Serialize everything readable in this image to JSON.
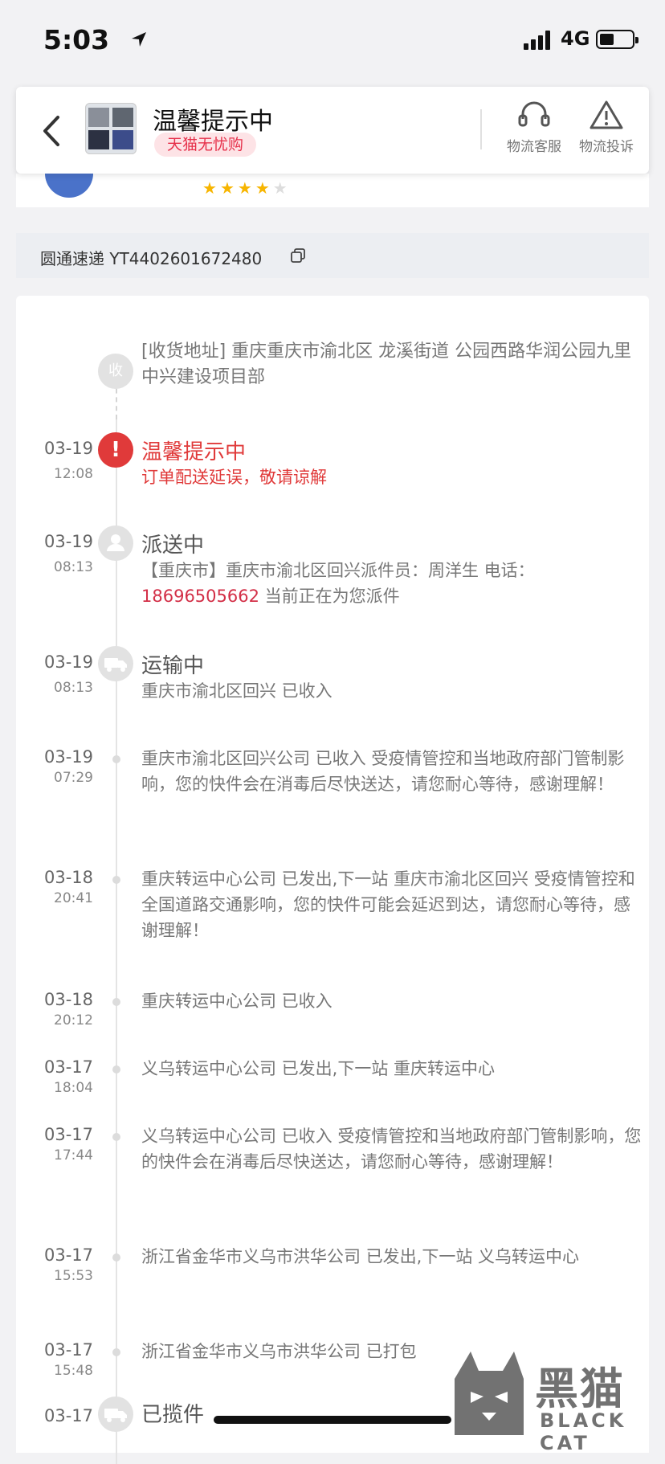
{
  "statusbar": {
    "time": "5:03",
    "network": "4G",
    "battery_level": 0.45
  },
  "header": {
    "title": "温馨提示中",
    "badge": "天猫无忧购",
    "actions": [
      {
        "label": "物流客服",
        "icon": "headset-icon"
      },
      {
        "label": "物流投诉",
        "icon": "warning-icon"
      }
    ]
  },
  "courier_row": {
    "rating_stars": 4,
    "rating_max": 5
  },
  "tracking": {
    "carrier": "圆通速递",
    "number": "YT4402601672480"
  },
  "address": {
    "node_label": "收",
    "text": "[收货地址] 重庆重庆市渝北区  龙溪街道   公园西路华润公园九里中兴建设项目部"
  },
  "events": [
    {
      "date": "03-19",
      "time": "12:08",
      "status": "温馨提示中",
      "node": "alert",
      "desc": "订单配送延误，敬请谅解"
    },
    {
      "date": "03-19",
      "time": "08:13",
      "status": "派送中",
      "node": "person",
      "desc_pre": "【重庆市】重庆市渝北区回兴派件员：周洋生 电话：",
      "phone": "18696505662",
      "desc_post": " 当前正在为您派件"
    },
    {
      "date": "03-19",
      "time": "08:13",
      "status": "运输中",
      "node": "truck",
      "desc": "重庆市渝北区回兴 已收入"
    },
    {
      "date": "03-19",
      "time": "07:29",
      "desc": "重庆市渝北区回兴公司 已收入 受疫情管控和当地政府部门管制影响，您的快件会在消毒后尽快送达，请您耐心等待，感谢理解！"
    },
    {
      "date": "03-18",
      "time": "20:41",
      "desc": "重庆转运中心公司 已发出,下一站 重庆市渝北区回兴 受疫情管控和全国道路交通影响，您的快件可能会延迟到达，请您耐心等待，感谢理解！"
    },
    {
      "date": "03-18",
      "time": "20:12",
      "desc": "重庆转运中心公司 已收入"
    },
    {
      "date": "03-17",
      "time": "18:04",
      "desc": "义乌转运中心公司 已发出,下一站 重庆转运中心"
    },
    {
      "date": "03-17",
      "time": "17:44",
      "desc": "义乌转运中心公司 已收入 受疫情管控和当地政府部门管制影响，您的快件会在消毒后尽快送达，请您耐心等待，感谢理解！"
    },
    {
      "date": "03-17",
      "time": "15:53",
      "desc": "浙江省金华市义乌市洪华公司 已发出,下一站 义乌转运中心"
    },
    {
      "date": "03-17",
      "time": "15:48",
      "desc": "浙江省金华市义乌市洪华公司 已打包"
    },
    {
      "date": "03-17",
      "status": "已揽件",
      "node": "truck"
    }
  ],
  "watermark": {
    "cn": "黑猫",
    "en": "BLACK CAT"
  }
}
